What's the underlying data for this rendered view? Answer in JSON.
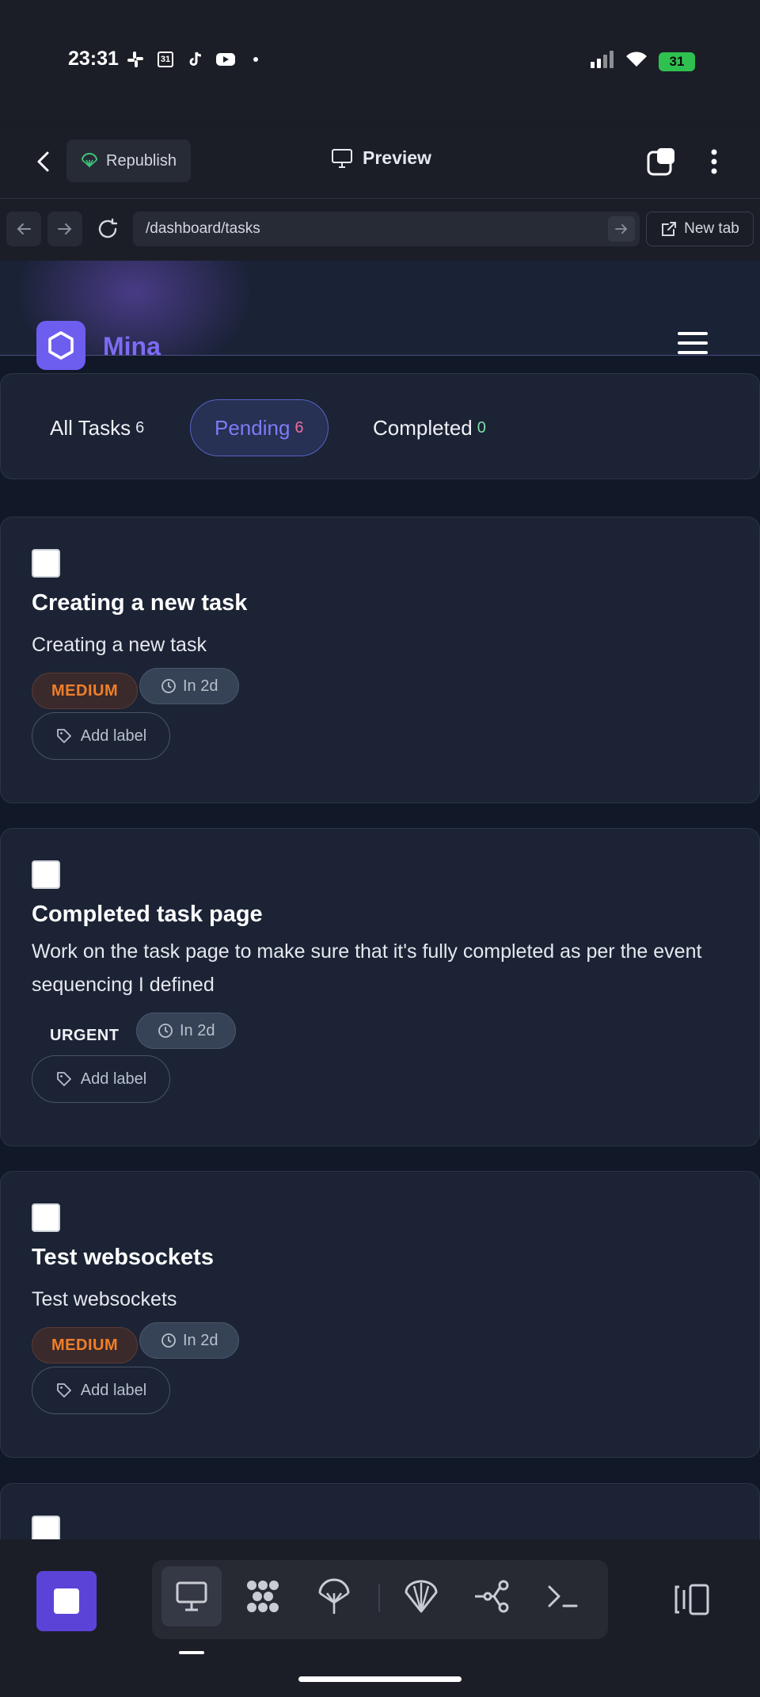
{
  "status_bar": {
    "time": "23:31",
    "app_icons": [
      "slack-icon",
      "calendar-icon",
      "tiktok-icon",
      "youtube-icon",
      "dot-icon"
    ],
    "calendar_day": "31",
    "battery": "31"
  },
  "topbar": {
    "republish_label": "Republish",
    "preview_label": "Preview"
  },
  "urlbar": {
    "url": "/dashboard/tasks",
    "new_tab_label": "New tab"
  },
  "site": {
    "brand": "Mina"
  },
  "filters": [
    {
      "label": "All Tasks",
      "count": "6"
    },
    {
      "label": "Pending",
      "count": "6",
      "active": true
    },
    {
      "label": "Completed",
      "count": "0"
    }
  ],
  "tasks": [
    {
      "title": "Creating a new task",
      "description": "Creating a new task",
      "priority": "MEDIUM",
      "due": "In 2d",
      "add_label": "Add label"
    },
    {
      "title": "Completed task page",
      "description": "Work on the task page to make sure that it's fully completed as per the event sequencing I defined",
      "priority": "URGENT",
      "due": "In 2d",
      "add_label": "Add label"
    },
    {
      "title": "Test websockets",
      "description": "Test websockets",
      "priority": "MEDIUM",
      "due": "In 2d",
      "add_label": "Add label"
    }
  ],
  "colors": {
    "accent": "#6d5ef0",
    "brand_text": "#7c6cf3",
    "medium_priority": "#f07f2a",
    "stop_button": "#5b43d8",
    "battery": "#2fc14f"
  },
  "dock": {
    "tools": [
      "desktop-icon",
      "agents-icon",
      "deploy-icon",
      "shell-icon",
      "git-icon",
      "terminal-icon"
    ]
  }
}
